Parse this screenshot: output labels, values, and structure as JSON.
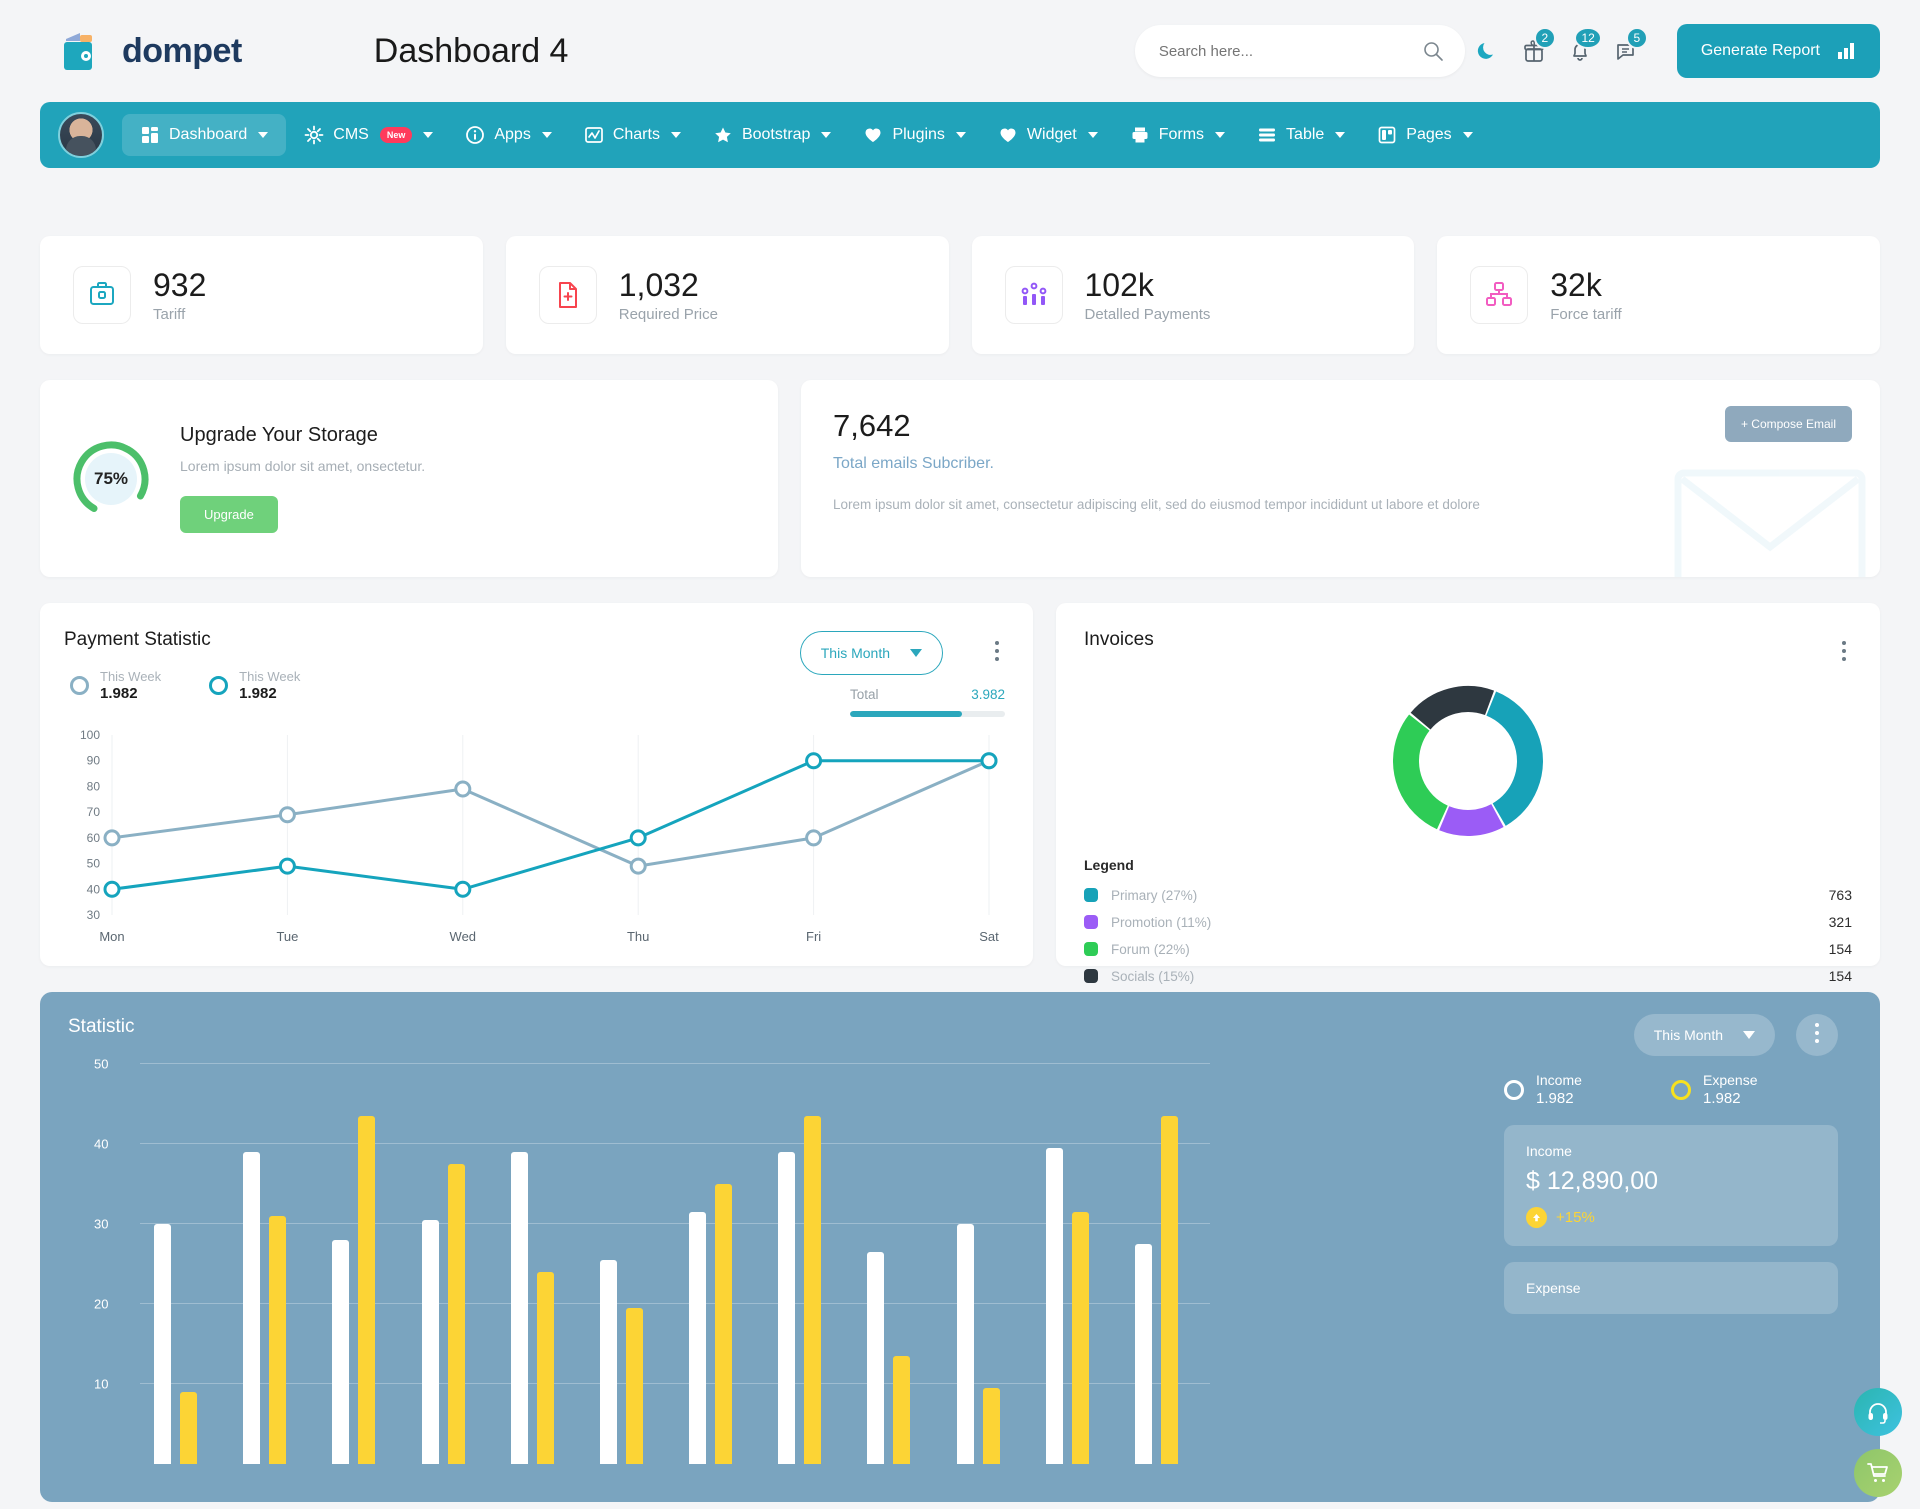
{
  "header": {
    "brand": "dompet",
    "page_title": "Dashboard 4",
    "search_placeholder": "Search here...",
    "search_value": "",
    "icons": [
      {
        "name": "moon-icon",
        "badge": null
      },
      {
        "name": "gift-icon",
        "badge": "2"
      },
      {
        "name": "bell-icon",
        "badge": "12"
      },
      {
        "name": "message-icon",
        "badge": "5"
      }
    ],
    "generate_report": "Generate Report"
  },
  "nav": {
    "items": [
      {
        "label": "Dashboard",
        "icon": "grid-icon",
        "active": true,
        "caret": true,
        "pill": null
      },
      {
        "label": "CMS",
        "icon": "gear-icon",
        "active": false,
        "caret": true,
        "pill": "New"
      },
      {
        "label": "Apps",
        "icon": "info-icon",
        "active": false,
        "caret": true,
        "pill": null
      },
      {
        "label": "Charts",
        "icon": "chart-icon",
        "active": false,
        "caret": true,
        "pill": null
      },
      {
        "label": "Bootstrap",
        "icon": "star-icon",
        "active": false,
        "caret": true,
        "pill": null
      },
      {
        "label": "Plugins",
        "icon": "heart-icon",
        "active": false,
        "caret": true,
        "pill": null
      },
      {
        "label": "Widget",
        "icon": "heart-icon",
        "active": false,
        "caret": true,
        "pill": null
      },
      {
        "label": "Forms",
        "icon": "printer-icon",
        "active": false,
        "caret": true,
        "pill": null
      },
      {
        "label": "Table",
        "icon": "list-icon",
        "active": false,
        "caret": true,
        "pill": null
      },
      {
        "label": "Pages",
        "icon": "book-icon",
        "active": false,
        "caret": true,
        "pill": null
      }
    ]
  },
  "stats": [
    {
      "value": "932",
      "label": "Tariff",
      "icon": "briefcase-icon",
      "color": "#1ca7c0"
    },
    {
      "value": "1,032",
      "label": "Required Price",
      "icon": "file-plus-icon",
      "color": "#f7444e"
    },
    {
      "value": "102k",
      "label": "Detalled Payments",
      "icon": "analytics-icon",
      "color": "#9257f7"
    },
    {
      "value": "32k",
      "label": "Force tariff",
      "icon": "hierarchy-icon",
      "color": "#f25cc1"
    }
  ],
  "storage": {
    "percent": "75%",
    "percent_value": 75,
    "title": "Upgrade Your Storage",
    "subtitle": "Lorem ipsum dolor sit amet, onsectetur.",
    "button": "Upgrade",
    "ring_color": "#4cbf6a"
  },
  "email": {
    "count": "7,642",
    "subtitle": "Total emails Subcriber.",
    "description": "Lorem ipsum dolor sit amet, consectetur adipiscing elit, sed do eiusmod tempor incididunt ut labore et dolore",
    "compose_button": "+ Compose Email"
  },
  "payment": {
    "title": "Payment Statistic",
    "legend": [
      {
        "label": "This Week",
        "value": "1.982",
        "color": "#8ab0c4"
      },
      {
        "label": "This Week",
        "value": "1.982",
        "color": "#15a4bd"
      }
    ],
    "period": "This Month",
    "total_label": "Total",
    "total_value": "3.982",
    "total_progress": 72
  },
  "invoices": {
    "title": "Invoices",
    "legend_header": "Legend",
    "items": [
      {
        "name": "Primary (27%)",
        "value": "763",
        "color": "#17a2b8",
        "percent": 27
      },
      {
        "name": "Promotion (11%)",
        "value": "321",
        "color": "#9b5cf6",
        "percent": 11
      },
      {
        "name": "Forum (22%)",
        "value": "154",
        "color": "#2ecc56",
        "percent": 22
      },
      {
        "name": "Socials (15%)",
        "value": "154",
        "color": "#2e3840",
        "percent": 15
      }
    ]
  },
  "statistic": {
    "title": "Statistic",
    "period": "This Month",
    "legend": [
      {
        "label": "Income",
        "value": "1.982",
        "color": "#ffffff"
      },
      {
        "label": "Expense",
        "value": "1.982",
        "color": "#f7e11e"
      }
    ],
    "cards": [
      {
        "label": "Income",
        "value": "$ 12,890,00",
        "delta": "+15%",
        "arrow": "up"
      },
      {
        "label": "Expense",
        "value": "",
        "delta": "",
        "arrow": "up"
      }
    ]
  },
  "floating": [
    {
      "name": "support-headset-icon",
      "label": "Support"
    },
    {
      "name": "shopping-cart-icon",
      "label": "Cart"
    }
  ],
  "chart_data": [
    {
      "type": "line",
      "title": "Payment Statistic",
      "categories": [
        "Mon",
        "Tue",
        "Wed",
        "Thu",
        "Fri",
        "Sat"
      ],
      "series": [
        {
          "name": "This Week",
          "color": "#8ab0c4",
          "values": [
            60,
            69,
            79,
            49,
            60,
            90
          ]
        },
        {
          "name": "This Week",
          "color": "#15a4bd",
          "values": [
            40,
            49,
            40,
            60,
            90,
            90
          ]
        }
      ],
      "ylim": [
        30,
        100
      ],
      "yticks": [
        30,
        40,
        50,
        60,
        70,
        80,
        90,
        100
      ],
      "xlabel": "",
      "ylabel": "",
      "grid": true,
      "legend_position": "top-left"
    },
    {
      "type": "pie",
      "title": "Invoices",
      "labels": [
        "Primary (27%)",
        "Promotion (11%)",
        "Forum (22%)",
        "Socials (15%)"
      ],
      "values": [
        27,
        11,
        22,
        15
      ],
      "counts": [
        763,
        321,
        154,
        154
      ],
      "colors": [
        "#17a2b8",
        "#9b5cf6",
        "#2ecc56",
        "#2e3840"
      ],
      "legend_position": "bottom"
    },
    {
      "type": "bar",
      "title": "Statistic",
      "ylim": [
        0,
        50
      ],
      "yticks": [
        10,
        20,
        30,
        40,
        50
      ],
      "grid": true,
      "series": [
        {
          "name": "Income",
          "color": "#ffffff",
          "values": [
            30,
            39,
            28,
            30.5,
            39,
            25.5,
            31.5,
            39,
            26.5,
            30,
            39.5,
            27.5
          ]
        },
        {
          "name": "Expense",
          "color": "#fcd435",
          "values": [
            9,
            31,
            43.5,
            37.5,
            24,
            19.5,
            35,
            43.5,
            13.5,
            9.5,
            31.5,
            43.5
          ]
        }
      ]
    }
  ]
}
